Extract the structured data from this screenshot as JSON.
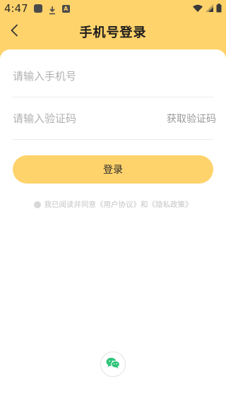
{
  "status_bar": {
    "time": "4:47",
    "a_badge": "A"
  },
  "nav": {
    "title": "手机号登录"
  },
  "form": {
    "phone_placeholder": "请输入手机号",
    "code_placeholder": "请输入验证码",
    "get_code_label": "获取验证码",
    "login_label": "登录"
  },
  "agreement": {
    "prefix": "我已阅读并同意",
    "user_agreement": "《用户协议》",
    "and": "和",
    "privacy_policy": "《隐私政策》"
  },
  "colors": {
    "accent": "#ffd36b",
    "wechat": "#2ec47a"
  },
  "icons": {
    "back": "chevron-left-icon",
    "wechat": "wechat-icon"
  }
}
